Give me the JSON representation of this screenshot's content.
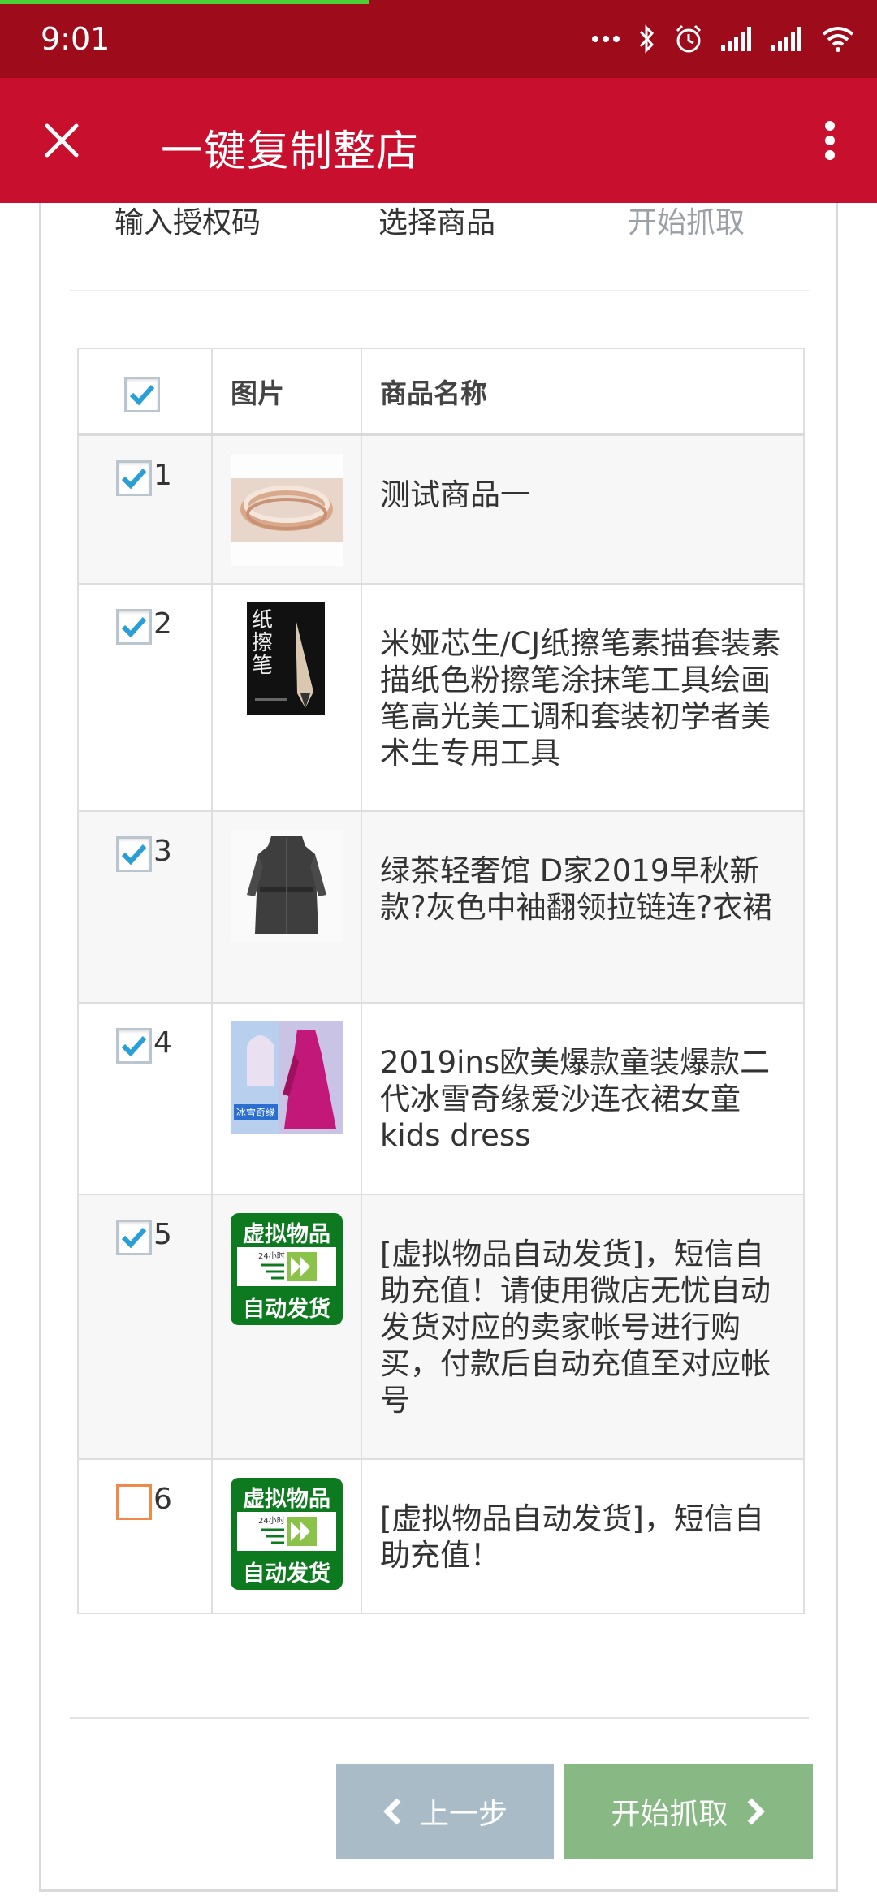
{
  "status_bar": {
    "time": "9:01",
    "icons": [
      "dots-icon",
      "bluetooth-icon",
      "alarm-icon",
      "signal-icon",
      "signal-icon",
      "wifi-icon"
    ]
  },
  "app_bar": {
    "title": "一键复制整店",
    "close_icon": "close-icon",
    "menu_icon": "more-vert-icon",
    "background": "#c8102e"
  },
  "steps": [
    "输入授权码",
    "选择商品",
    "开始抓取"
  ],
  "table": {
    "headers": {
      "image": "图片",
      "name": "商品名称"
    },
    "select_all_checked": true,
    "rows": [
      {
        "num": "1",
        "checked": true,
        "name": "测试商品一",
        "thumb": "bracelet"
      },
      {
        "num": "2",
        "checked": true,
        "name": "米娅芯生/CJ纸擦笔素描套装素描纸色粉擦笔涂抹笔工具绘画笔高光美工调和套装初学者美术生专用工具",
        "thumb": "pencil",
        "thumb_text": "纸擦笔"
      },
      {
        "num": "3",
        "checked": true,
        "name": "绿茶轻奢馆 D家2019早秋新款?灰色中袖翻领拉链连?衣裙",
        "thumb": "dress-gray"
      },
      {
        "num": "4",
        "checked": true,
        "name": "2019ins欧美爆款童装爆款二代冰雪奇缘爱沙连衣裙女童 kids dress",
        "thumb": "dress-pink",
        "thumb_text": "冰雪奇缘"
      },
      {
        "num": "5",
        "checked": true,
        "name": "[虚拟物品自动发货]，短信自助充值！请使用微店无忧自动发货对应的卖家帐号进行购买，付款后自动充值至对应帐号",
        "thumb": "virtual",
        "badge_top": "虚拟物品",
        "badge_bottom": "自动发货",
        "badge_small": "24小时"
      },
      {
        "num": "6",
        "checked": false,
        "name": "[虚拟物品自动发货]，短信自助充值！",
        "thumb": "virtual",
        "badge_top": "虚拟物品",
        "badge_bottom": "自动发货",
        "badge_small": "24小时"
      }
    ]
  },
  "buttons": {
    "prev": "上一步",
    "next": "开始抓取"
  },
  "colors": {
    "status_bar": "#9e0c1c",
    "app_bar": "#c8102e",
    "prev_button": "#a8bbc6",
    "next_button": "#88b985",
    "check": "#2a9fd6",
    "unchecked_border": "#f08a4b"
  }
}
